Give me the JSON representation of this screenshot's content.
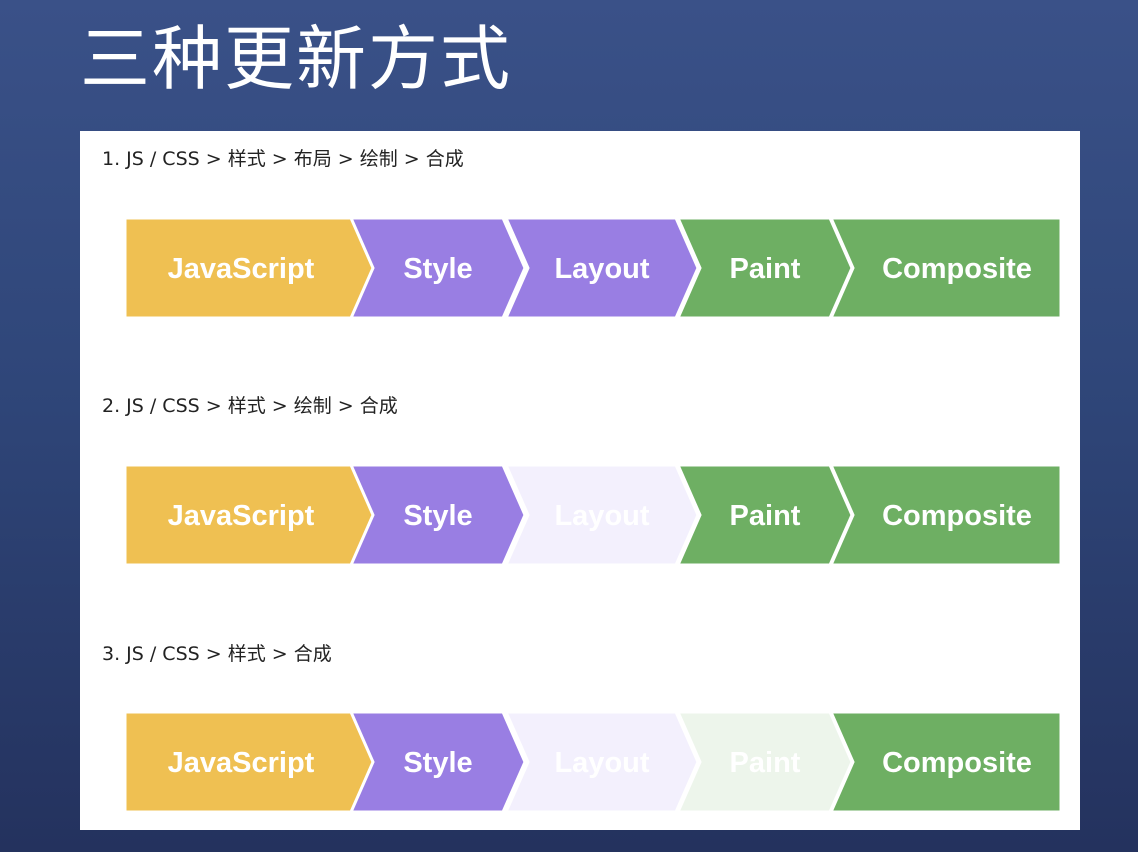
{
  "title": "三种更新方式",
  "colors": {
    "javascript": "#efc052",
    "style": "#997ee3",
    "layout": "#997ee3",
    "paint": "#6eaf63",
    "composite": "#6eaf63",
    "layout_faded": "#f3f0fd",
    "paint_faded": "#edf5eb",
    "text": "#ffffff"
  },
  "pipelines": [
    {
      "caption": "1. JS / CSS > 样式 > 布局 > 绘制 > 合成",
      "stages": [
        {
          "key": "javascript",
          "label": "JavaScript",
          "active": true
        },
        {
          "key": "style",
          "label": "Style",
          "active": true
        },
        {
          "key": "layout",
          "label": "Layout",
          "active": true
        },
        {
          "key": "paint",
          "label": "Paint",
          "active": true
        },
        {
          "key": "composite",
          "label": "Composite",
          "active": true
        }
      ]
    },
    {
      "caption": "2. JS / CSS > 样式 > 绘制 > 合成",
      "stages": [
        {
          "key": "javascript",
          "label": "JavaScript",
          "active": true
        },
        {
          "key": "style",
          "label": "Style",
          "active": true
        },
        {
          "key": "layout",
          "label": "Layout",
          "active": false
        },
        {
          "key": "paint",
          "label": "Paint",
          "active": true
        },
        {
          "key": "composite",
          "label": "Composite",
          "active": true
        }
      ]
    },
    {
      "caption": "3. JS / CSS > 样式 > 合成",
      "stages": [
        {
          "key": "javascript",
          "label": "JavaScript",
          "active": true
        },
        {
          "key": "style",
          "label": "Style",
          "active": true
        },
        {
          "key": "layout",
          "label": "Layout",
          "active": false
        },
        {
          "key": "paint",
          "label": "Paint",
          "active": false
        },
        {
          "key": "composite",
          "label": "Composite",
          "active": true
        }
      ]
    }
  ]
}
